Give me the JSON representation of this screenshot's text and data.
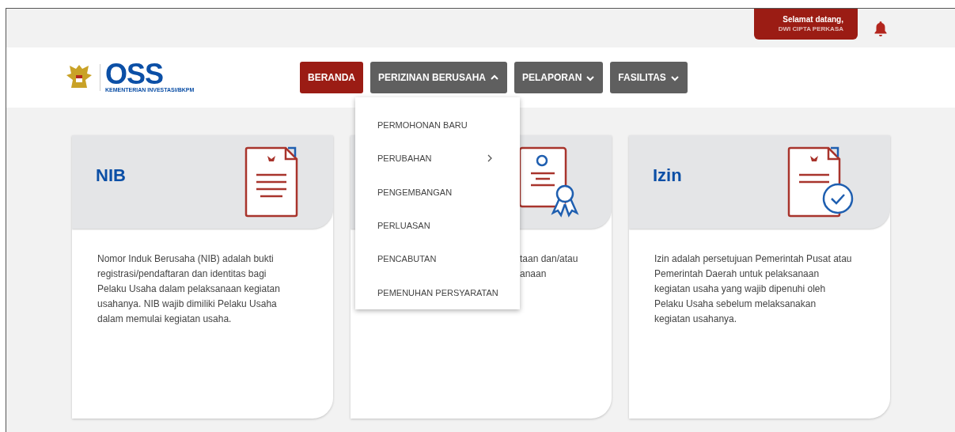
{
  "top_bar": {
    "welcome": "Selamat datang,",
    "user": "DWI CIPTA PERKASA"
  },
  "logo": {
    "name": "OSS",
    "subtitle": "KEMENTERIAN INVESTASI/BKPM"
  },
  "nav": [
    {
      "label": "BERANDA",
      "selected": true,
      "kind": "link"
    },
    {
      "label": "PERIZINAN BERUSAHA",
      "selected": false,
      "kind": "menu",
      "expanded": true
    },
    {
      "label": "PELAPORAN",
      "selected": false,
      "kind": "menu",
      "expanded": false
    },
    {
      "label": "FASILITAS",
      "selected": false,
      "kind": "menu",
      "expanded": false
    }
  ],
  "dropdown": [
    {
      "label": "PERMOHONAN BARU",
      "submenu": false
    },
    {
      "label": "PERUBAHAN",
      "submenu": true
    },
    {
      "label": "PENGEMBANGAN",
      "submenu": false
    },
    {
      "label": "PERLUASAN",
      "submenu": false
    },
    {
      "label": "PENCABUTAN",
      "submenu": false
    },
    {
      "label": "PEMENUHAN PERSYARATAN",
      "submenu": false
    }
  ],
  "cards": [
    {
      "kind": "nib",
      "title": "NIB",
      "description": "Nomor Induk Berusaha (NIB) adalah bukti registrasi/pendaftaran dan identitas bagi Pelaku Usaha dalam pelaksanaan kegiatan usahanya. NIB wajib dimiliki Pelaku Usaha dalam memulai kegiatan usaha."
    },
    {
      "kind": "certificate",
      "description_lines": [
        "taan dan/atau",
        "anaan"
      ]
    },
    {
      "kind": "izin",
      "title": "Izin",
      "description": "Izin adalah persetujuan Pemerintah Pusat atau Pemerintah Daerah untuk pelaksanaan kegiatan usaha yang wajib dipenuhi oleh Pelaku Usaha sebelum melaksanakan kegiatan usahanya."
    }
  ]
}
